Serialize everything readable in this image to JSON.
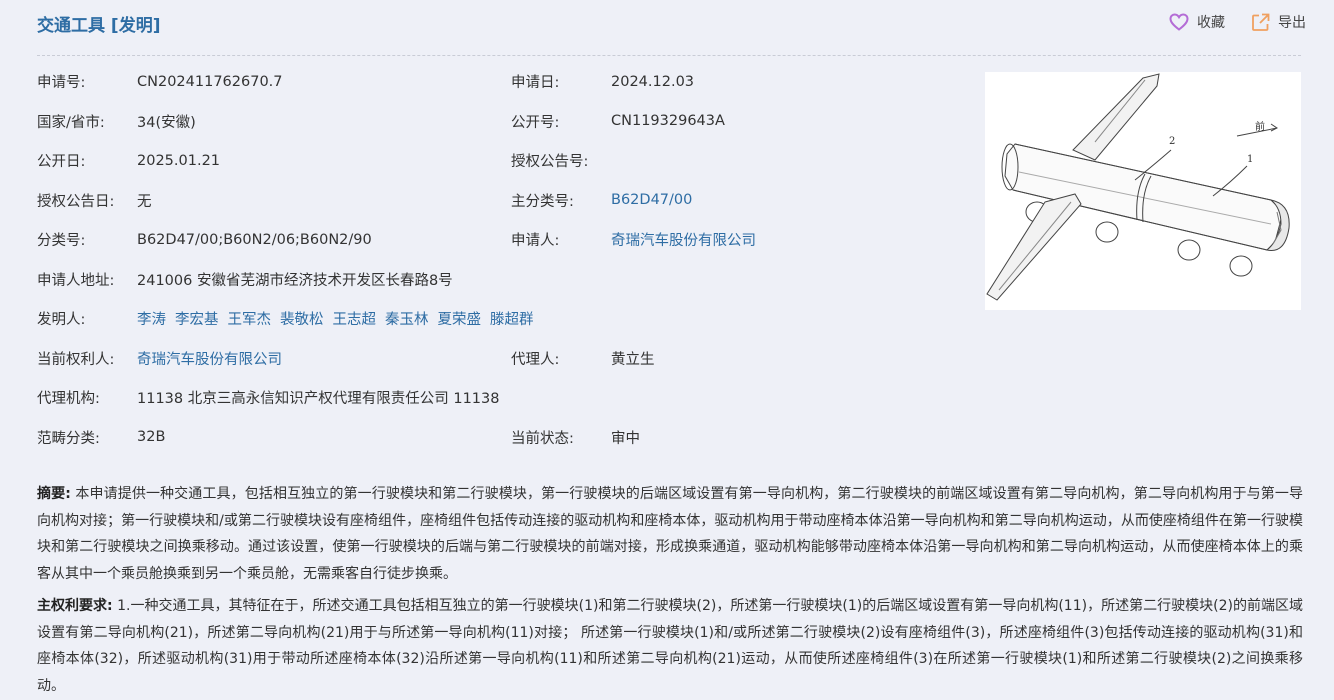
{
  "header": {
    "title": "交通工具 [发明]",
    "favorite_label": "收藏",
    "export_label": "导出"
  },
  "colors": {
    "link": "#2e6da4",
    "favorite_icon": "#b46cd6",
    "export_icon": "#f0a060"
  },
  "fields": {
    "application_no": {
      "label": "申请号:",
      "value": "CN202411762670.7"
    },
    "application_date": {
      "label": "申请日:",
      "value": "2024.12.03"
    },
    "country": {
      "label": "国家/省市:",
      "value": "34(安徽)"
    },
    "publication_no": {
      "label": "公开号:",
      "value": "CN119329643A"
    },
    "publication_date": {
      "label": "公开日:",
      "value": "2025.01.21"
    },
    "grant_pub_no": {
      "label": "授权公告号:",
      "value": ""
    },
    "grant_pub_date": {
      "label": "授权公告日:",
      "value": "无"
    },
    "main_class": {
      "label": "主分类号:",
      "value": "B62D47/00"
    },
    "class_no": {
      "label": "分类号:",
      "value": "B62D47/00;B60N2/06;B60N2/90"
    },
    "applicant": {
      "label": "申请人:",
      "value": "奇瑞汽车股份有限公司"
    },
    "applicant_address": {
      "label": "申请人地址:",
      "value": "241006 安徽省芜湖市经济技术开发区长春路8号"
    },
    "inventors": {
      "label": "发明人:",
      "names": [
        "李涛",
        "李宏基",
        "王军杰",
        "裴敬松",
        "王志超",
        "秦玉林",
        "夏荣盛",
        "滕超群"
      ]
    },
    "current_owner": {
      "label": "当前权利人:",
      "value": "奇瑞汽车股份有限公司"
    },
    "agent": {
      "label": "代理人:",
      "value": "黄立生"
    },
    "agency": {
      "label": "代理机构:",
      "value": "11138 北京三高永信知识产权代理有限责任公司 11138"
    },
    "category": {
      "label": "范畴分类:",
      "value": "32B"
    },
    "status": {
      "label": "当前状态:",
      "value": "审中"
    }
  },
  "figure": {
    "labels": [
      "前",
      "2",
      "1"
    ]
  },
  "abstract": {
    "label": "摘要:",
    "text": "本申请提供一种交通工具，包括相互独立的第一行驶模块和第二行驶模块，第一行驶模块的后端区域设置有第一导向机构，第二行驶模块的前端区域设置有第二导向机构，第二导向机构用于与第一导向机构对接；第一行驶模块和/或第二行驶模块设有座椅组件，座椅组件包括传动连接的驱动机构和座椅本体，驱动机构用于带动座椅本体沿第一导向机构和第二导向机构运动，从而使座椅组件在第一行驶模块和第二行驶模块之间换乘移动。通过该设置，使第一行驶模块的后端与第二行驶模块的前端对接，形成换乘通道，驱动机构能够带动座椅本体沿第一导向机构和第二导向机构运动，从而使座椅本体上的乘客从其中一个乘员舱换乘到另一个乘员舱，无需乘客自行徒步换乘。"
  },
  "claims": {
    "label": "主权利要求:",
    "text": "1.一种交通工具，其特征在于，所述交通工具包括相互独立的第一行驶模块(1)和第二行驶模块(2)，所述第一行驶模块(1)的后端区域设置有第一导向机构(11)，所述第二行驶模块(2)的前端区域设置有第二导向机构(21)，所述第二导向机构(21)用于与所述第一导向机构(11)对接； 所述第一行驶模块(1)和/或所述第二行驶模块(2)设有座椅组件(3)，所述座椅组件(3)包括传动连接的驱动机构(31)和座椅本体(32)，所述驱动机构(31)用于带动所述座椅本体(32)沿所述第一导向机构(11)和所述第二导向机构(21)运动，从而使所述座椅组件(3)在所述第一行驶模块(1)和所述第二行驶模块(2)之间换乘移动。"
  }
}
